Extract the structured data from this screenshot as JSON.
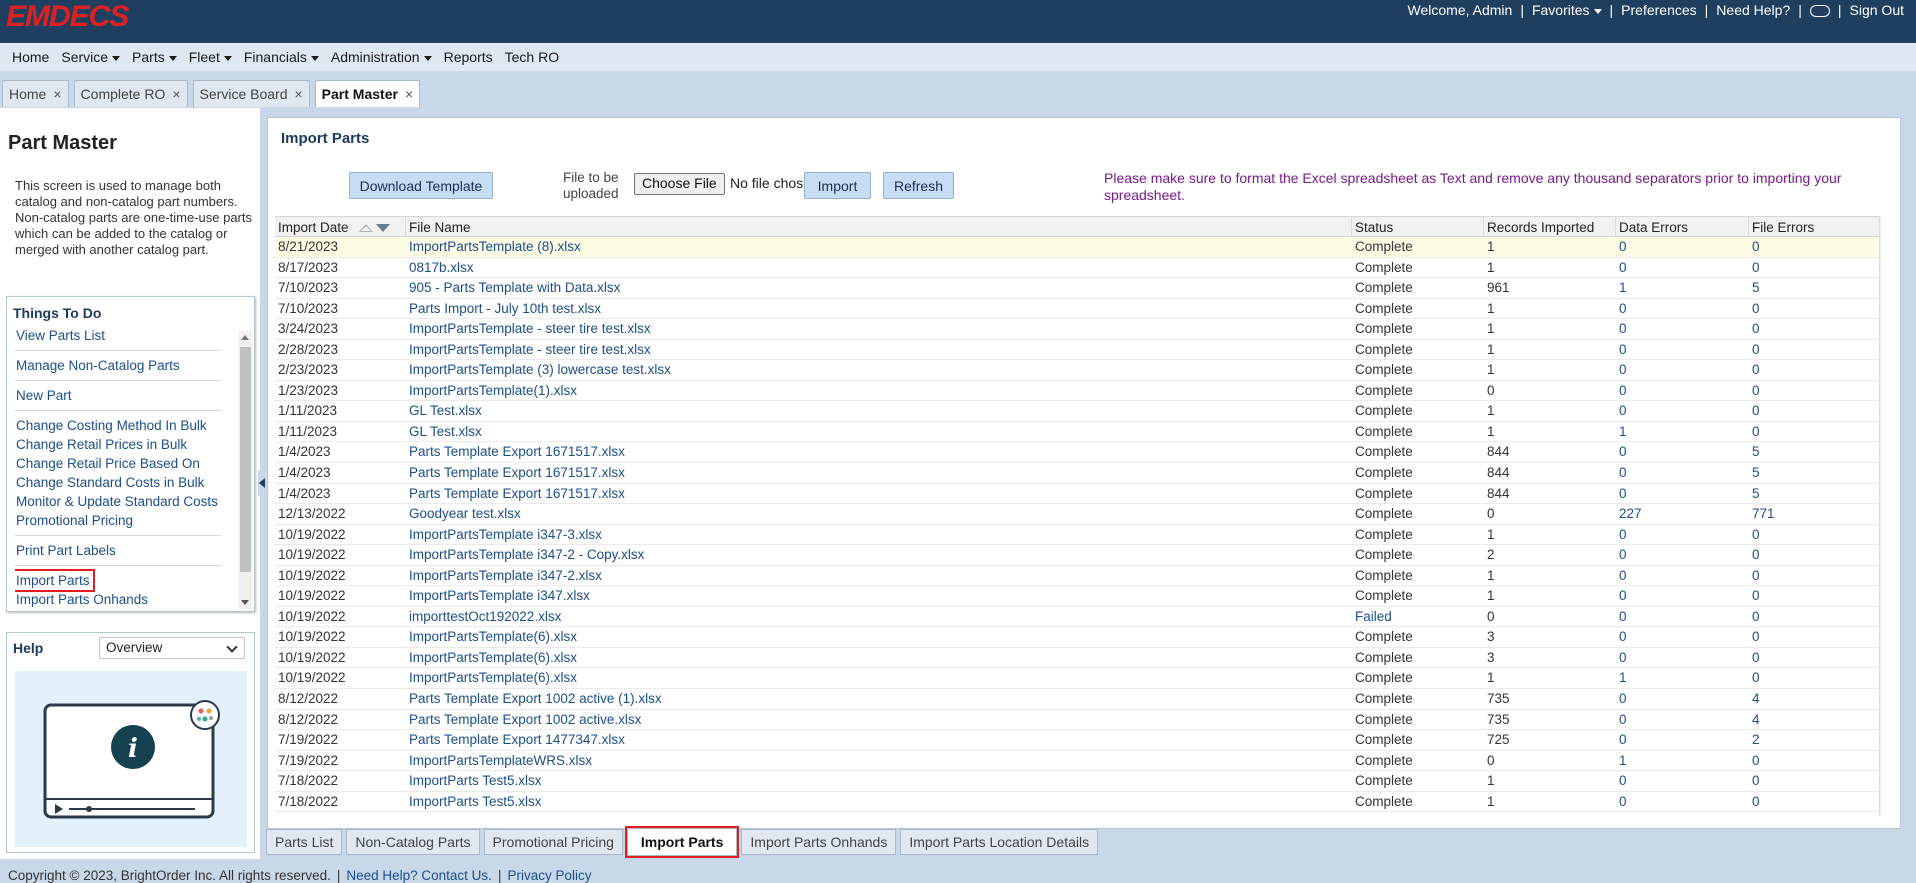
{
  "header": {
    "logo": "EMDECS",
    "welcome": "Welcome, Admin",
    "favorites": "Favorites",
    "preferences": "Preferences",
    "need_help": "Need Help?",
    "sign_out": "Sign Out"
  },
  "menu": [
    "Home",
    "Service",
    "Parts",
    "Fleet",
    "Financials",
    "Administration",
    "Reports",
    "Tech RO"
  ],
  "menu_dropdowns": [
    false,
    true,
    true,
    true,
    true,
    true,
    false,
    false
  ],
  "tabs": [
    {
      "label": "Home"
    },
    {
      "label": "Complete RO"
    },
    {
      "label": "Service Board"
    },
    {
      "label": "Part Master",
      "active": true
    }
  ],
  "left": {
    "title": "Part Master",
    "description": "This screen is used to manage both catalog and non-catalog part numbers. Non-catalog parts are one-time-use parts which can be added to the catalog or merged with another catalog part.",
    "todo_title": "Things To Do",
    "todo_groups": [
      [
        "View Parts List"
      ],
      [
        "Manage Non-Catalog Parts"
      ],
      [
        "New Part"
      ],
      [
        "Change Costing Method In Bulk",
        "Change Retail Prices in Bulk",
        "Change Retail Price Based On",
        "Change Standard Costs in Bulk",
        "Monitor & Update Standard Costs",
        "Promotional Pricing"
      ],
      [
        "Print Part Labels"
      ],
      [
        "Import Parts",
        "Import Parts Onhands"
      ]
    ],
    "help_title": "Help",
    "help_option": "Overview"
  },
  "main": {
    "title": "Import Parts",
    "download_button": "Download Template",
    "file_label_1": "File to be",
    "file_label_2": "uploaded",
    "choose_file": "Choose File",
    "no_file": "No file chosen",
    "import_button": "Import",
    "refresh_button": "Refresh",
    "notice": "Please make sure to format the Excel spreadsheet as Text and remove any thousand separators prior to importing your spreadsheet."
  },
  "table": {
    "columns": [
      "Import Date",
      "File Name",
      "Status",
      "Records Imported",
      "Data Errors",
      "File Errors"
    ],
    "rows": [
      [
        "8/21/2023",
        "ImportPartsTemplate (8).xlsx",
        "Complete",
        "1",
        "0",
        "0"
      ],
      [
        "8/17/2023",
        "0817b.xlsx",
        "Complete",
        "1",
        "0",
        "0"
      ],
      [
        "7/10/2023",
        "905 - Parts Template with Data.xlsx",
        "Complete",
        "961",
        "1",
        "5"
      ],
      [
        "7/10/2023",
        "Parts Import - July 10th test.xlsx",
        "Complete",
        "1",
        "0",
        "0"
      ],
      [
        "3/24/2023",
        "ImportPartsTemplate - steer tire test.xlsx",
        "Complete",
        "1",
        "0",
        "0"
      ],
      [
        "2/28/2023",
        "ImportPartsTemplate - steer tire test.xlsx",
        "Complete",
        "1",
        "0",
        "0"
      ],
      [
        "2/23/2023",
        "ImportPartsTemplate (3) lowercase test.xlsx",
        "Complete",
        "1",
        "0",
        "0"
      ],
      [
        "1/23/2023",
        "ImportPartsTemplate(1).xlsx",
        "Complete",
        "0",
        "0",
        "0"
      ],
      [
        "1/11/2023",
        "GL Test.xlsx",
        "Complete",
        "1",
        "0",
        "0"
      ],
      [
        "1/11/2023",
        "GL Test.xlsx",
        "Complete",
        "1",
        "1",
        "0"
      ],
      [
        "1/4/2023",
        "Parts Template Export 1671517.xlsx",
        "Complete",
        "844",
        "0",
        "5"
      ],
      [
        "1/4/2023",
        "Parts Template Export 1671517.xlsx",
        "Complete",
        "844",
        "0",
        "5"
      ],
      [
        "1/4/2023",
        "Parts Template Export 1671517.xlsx",
        "Complete",
        "844",
        "0",
        "5"
      ],
      [
        "12/13/2022",
        "Goodyear test.xlsx",
        "Complete",
        "0",
        "227",
        "771"
      ],
      [
        "10/19/2022",
        "ImportPartsTemplate i347-3.xlsx",
        "Complete",
        "1",
        "0",
        "0"
      ],
      [
        "10/19/2022",
        "ImportPartsTemplate i347-2 - Copy.xlsx",
        "Complete",
        "2",
        "0",
        "0"
      ],
      [
        "10/19/2022",
        "ImportPartsTemplate i347-2.xlsx",
        "Complete",
        "1",
        "0",
        "0"
      ],
      [
        "10/19/2022",
        "ImportPartsTemplate i347.xlsx",
        "Complete",
        "1",
        "0",
        "0"
      ],
      [
        "10/19/2022",
        "importtestOct192022.xlsx",
        "Failed",
        "0",
        "0",
        "0"
      ],
      [
        "10/19/2022",
        "ImportPartsTemplate(6).xlsx",
        "Complete",
        "3",
        "0",
        "0"
      ],
      [
        "10/19/2022",
        "ImportPartsTemplate(6).xlsx",
        "Complete",
        "3",
        "0",
        "0"
      ],
      [
        "10/19/2022",
        "ImportPartsTemplate(6).xlsx",
        "Complete",
        "1",
        "1",
        "0"
      ],
      [
        "8/12/2022",
        "Parts Template Export 1002 active (1).xlsx",
        "Complete",
        "735",
        "0",
        "4"
      ],
      [
        "8/12/2022",
        "Parts Template Export 1002 active.xlsx",
        "Complete",
        "735",
        "0",
        "4"
      ],
      [
        "7/19/2022",
        "Parts Template Export 1477347.xlsx",
        "Complete",
        "725",
        "0",
        "2"
      ],
      [
        "7/19/2022",
        "ImportPartsTemplateWRS.xlsx",
        "Complete",
        "0",
        "1",
        "0"
      ],
      [
        "7/18/2022",
        "ImportParts Test5.xlsx",
        "Complete",
        "1",
        "0",
        "0"
      ],
      [
        "7/18/2022",
        "ImportParts Test5.xlsx",
        "Complete",
        "1",
        "0",
        "0"
      ]
    ]
  },
  "bottom_tabs": [
    {
      "label": "Parts List"
    },
    {
      "label": "Non-Catalog Parts"
    },
    {
      "label": "Promotional Pricing"
    },
    {
      "label": "Import Parts",
      "active": true
    },
    {
      "label": "Import Parts Onhands"
    },
    {
      "label": "Import Parts Location Details"
    }
  ],
  "footer": {
    "copyright": "Copyright © 2023, BrightOrder Inc. All rights reserved.",
    "help_link": "Need Help? Contact Us.",
    "privacy": "Privacy Policy"
  },
  "colors": {
    "header_bg": "#1f3f60",
    "logo": "#e02020",
    "link": "#1d4e89",
    "notice": "#7a1a8a",
    "highlight": "#e02020"
  }
}
